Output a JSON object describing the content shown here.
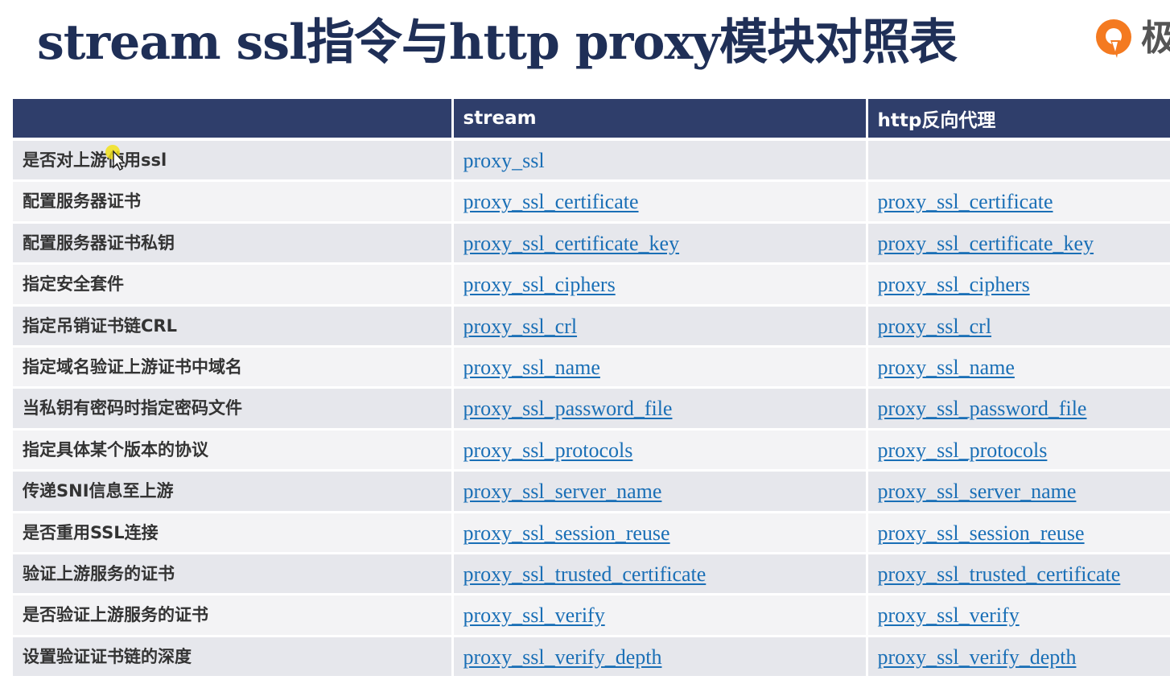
{
  "title": "stream ssl指令与http proxy模块对照表",
  "logo": {
    "text": "极",
    "icon": "geek-logo-icon",
    "color": "#f47a20"
  },
  "colors": {
    "header_bg": "#2f3e6b",
    "link": "#1a6fb6",
    "row_odd": "#e6e7ec",
    "row_even": "#f3f3f5",
    "title": "#1f2f57"
  },
  "table": {
    "headers": [
      "",
      "stream",
      "http反向代理"
    ],
    "rows": [
      {
        "label": "是否对上游使用ssl",
        "stream": "proxy_ssl",
        "http": ""
      },
      {
        "label": "配置服务器证书",
        "stream": "proxy_ssl_certificate",
        "http": "proxy_ssl_certificate"
      },
      {
        "label": "配置服务器证书私钥",
        "stream": "proxy_ssl_certificate_key",
        "http": "proxy_ssl_certificate_key"
      },
      {
        "label": "指定安全套件",
        "stream": "proxy_ssl_ciphers",
        "http": "proxy_ssl_ciphers"
      },
      {
        "label": "指定吊销证书链CRL",
        "stream": "proxy_ssl_crl",
        "http": "proxy_ssl_crl"
      },
      {
        "label": "指定域名验证上游证书中域名",
        "stream": "proxy_ssl_name",
        "http": "proxy_ssl_name"
      },
      {
        "label": "当私钥有密码时指定密码文件",
        "stream": "proxy_ssl_password_file",
        "http": "proxy_ssl_password_file"
      },
      {
        "label": "指定具体某个版本的协议",
        "stream": "proxy_ssl_protocols",
        "http": "proxy_ssl_protocols"
      },
      {
        "label": "传递SNI信息至上游",
        "stream": "proxy_ssl_server_name",
        "http": "proxy_ssl_server_name"
      },
      {
        "label": "是否重用SSL连接",
        "stream": "proxy_ssl_session_reuse",
        "http": "proxy_ssl_session_reuse"
      },
      {
        "label": "验证上游服务的证书",
        "stream": "proxy_ssl_trusted_certificate",
        "http": "proxy_ssl_trusted_certificate"
      },
      {
        "label": "是否验证上游服务的证书",
        "stream": "proxy_ssl_verify",
        "http": "proxy_ssl_verify"
      },
      {
        "label": "设置验证证书链的深度",
        "stream": "proxy_ssl_verify_depth",
        "http": "proxy_ssl_verify_depth"
      }
    ]
  }
}
